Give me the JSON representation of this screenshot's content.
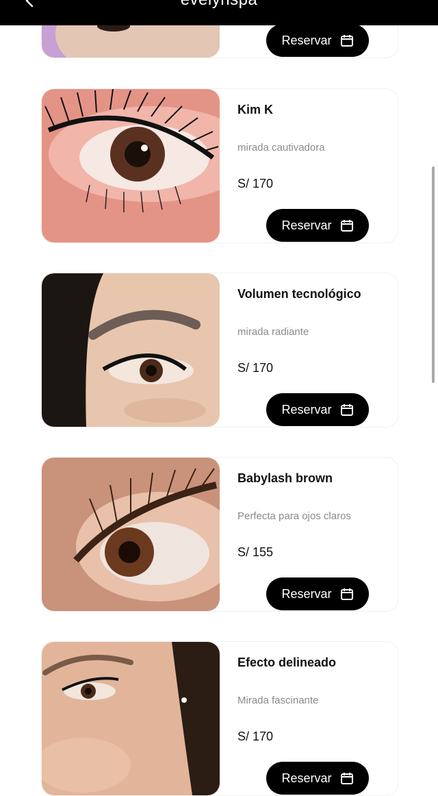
{
  "header": {
    "brand": "evelynspa"
  },
  "reserve_label": "Reservar",
  "cards": [
    {
      "title": "",
      "subtitle": "",
      "price": ""
    },
    {
      "title": "Kim K",
      "subtitle": "mirada cautivadora",
      "price": "S/ 170"
    },
    {
      "title": "Volumen tecnológico",
      "subtitle": "mirada radiante",
      "price": "S/ 170"
    },
    {
      "title": "Babylash brown",
      "subtitle": "Perfecta para ojos claros",
      "price": "S/ 155"
    },
    {
      "title": "Efecto delineado",
      "subtitle": "Mirada fascinante",
      "price": "S/ 170"
    }
  ],
  "colors": {
    "bar": "#000000",
    "button": "#000000",
    "muted_text": "#8a8a8a"
  },
  "icons": {
    "back": "chevron-left-icon",
    "calendar": "calendar-icon"
  }
}
